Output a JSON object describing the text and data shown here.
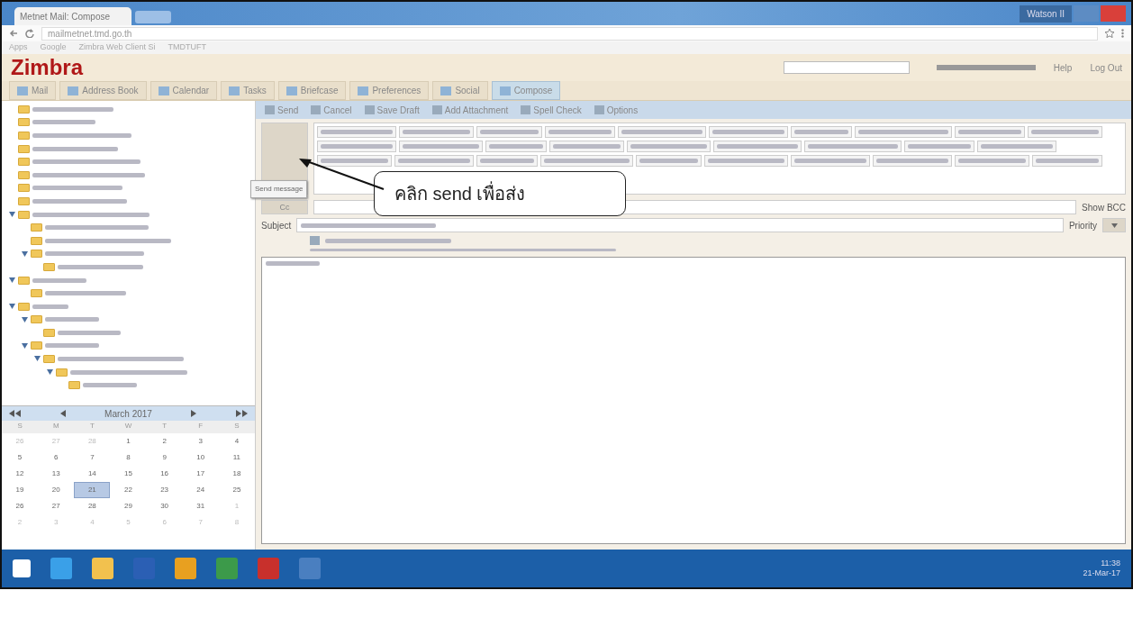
{
  "browser": {
    "tab_title": "Metnet Mail: Compose",
    "url": "mailmetnet.tmd.go.th",
    "bookmarks": [
      "Apps",
      "Google",
      "Zimbra Web Client Si",
      "TMDTUFT"
    ],
    "user_badge": "Watson II"
  },
  "app": {
    "logo": "Zimbra",
    "help": "Help",
    "logout": "Log Out",
    "tabs": [
      {
        "label": "Mail",
        "selected": false
      },
      {
        "label": "Address Book",
        "selected": false
      },
      {
        "label": "Calendar",
        "selected": false
      },
      {
        "label": "Tasks",
        "selected": false
      },
      {
        "label": "Briefcase",
        "selected": false
      },
      {
        "label": "Preferences",
        "selected": false
      },
      {
        "label": "Social",
        "selected": false
      },
      {
        "label": "Compose",
        "selected": true
      }
    ]
  },
  "folders": [
    {
      "expanded": false
    },
    {
      "expanded": false
    },
    {
      "expanded": false
    },
    {
      "expanded": false
    },
    {
      "expanded": false
    },
    {
      "expanded": false
    },
    {
      "expanded": false
    },
    {
      "expanded": false
    },
    {
      "expanded": true,
      "children": [
        {
          "expanded": false
        },
        {
          "expanded": false
        },
        {
          "expanded": true,
          "children": [
            {
              "expanded": false
            }
          ]
        }
      ]
    },
    {
      "expanded": true,
      "children": [
        {
          "expanded": false
        }
      ]
    },
    {
      "expanded": true,
      "children": [
        {
          "expanded": true,
          "children": [
            {
              "expanded": false
            }
          ]
        },
        {
          "expanded": true,
          "children": [
            {
              "expanded": true,
              "children": [
                {
                  "expanded": true,
                  "children": [
                    {
                      "expanded": false
                    }
                  ]
                }
              ]
            }
          ]
        }
      ]
    }
  ],
  "calendar": {
    "month": "March 2017",
    "weekdays": [
      "S",
      "M",
      "T",
      "W",
      "T",
      "F",
      "S"
    ],
    "days": [
      {
        "day": "26",
        "other": true,
        "selected": false
      },
      {
        "day": "27",
        "other": true,
        "selected": false
      },
      {
        "day": "28",
        "other": true,
        "selected": false
      },
      {
        "day": "1",
        "other": false,
        "selected": false
      },
      {
        "day": "2",
        "other": false,
        "selected": false
      },
      {
        "day": "3",
        "other": false,
        "selected": false
      },
      {
        "day": "4",
        "other": false,
        "selected": false
      },
      {
        "day": "5",
        "other": false,
        "selected": false
      },
      {
        "day": "6",
        "other": false,
        "selected": false
      },
      {
        "day": "7",
        "other": false,
        "selected": false
      },
      {
        "day": "8",
        "other": false,
        "selected": false
      },
      {
        "day": "9",
        "other": false,
        "selected": false
      },
      {
        "day": "10",
        "other": false,
        "selected": false
      },
      {
        "day": "11",
        "other": false,
        "selected": false
      },
      {
        "day": "12",
        "other": false,
        "selected": false
      },
      {
        "day": "13",
        "other": false,
        "selected": false
      },
      {
        "day": "14",
        "other": false,
        "selected": false
      },
      {
        "day": "15",
        "other": false,
        "selected": false
      },
      {
        "day": "16",
        "other": false,
        "selected": false
      },
      {
        "day": "17",
        "other": false,
        "selected": false
      },
      {
        "day": "18",
        "other": false,
        "selected": false
      },
      {
        "day": "19",
        "other": false,
        "selected": false
      },
      {
        "day": "20",
        "other": false,
        "selected": false
      },
      {
        "day": "21",
        "other": false,
        "selected": true
      },
      {
        "day": "22",
        "other": false,
        "selected": false
      },
      {
        "day": "23",
        "other": false,
        "selected": false
      },
      {
        "day": "24",
        "other": false,
        "selected": false
      },
      {
        "day": "25",
        "other": false,
        "selected": false
      },
      {
        "day": "26",
        "other": false,
        "selected": false
      },
      {
        "day": "27",
        "other": false,
        "selected": false
      },
      {
        "day": "28",
        "other": false,
        "selected": false
      },
      {
        "day": "29",
        "other": false,
        "selected": false
      },
      {
        "day": "30",
        "other": false,
        "selected": false
      },
      {
        "day": "31",
        "other": false,
        "selected": false
      },
      {
        "day": "1",
        "other": true,
        "selected": false
      },
      {
        "day": "2",
        "other": true,
        "selected": false
      },
      {
        "day": "3",
        "other": true,
        "selected": false
      },
      {
        "day": "4",
        "other": true,
        "selected": false
      },
      {
        "day": "5",
        "other": true,
        "selected": false
      },
      {
        "day": "6",
        "other": true,
        "selected": false
      },
      {
        "day": "7",
        "other": true,
        "selected": false
      },
      {
        "day": "8",
        "other": true,
        "selected": false
      }
    ]
  },
  "compose": {
    "toolbar": [
      "Send",
      "Cancel",
      "Save Draft",
      "Add Attachment",
      "Spell Check",
      "Options"
    ],
    "tooltip": "Send message",
    "cc_label": "Cc",
    "show_bcc": "Show BCC",
    "subject_label": "Subject",
    "priority_label": "Priority"
  },
  "callout": "คลิก send เพื่อส่ง",
  "taskbar": {
    "time": "11:38",
    "date": "21-Mar-17"
  }
}
